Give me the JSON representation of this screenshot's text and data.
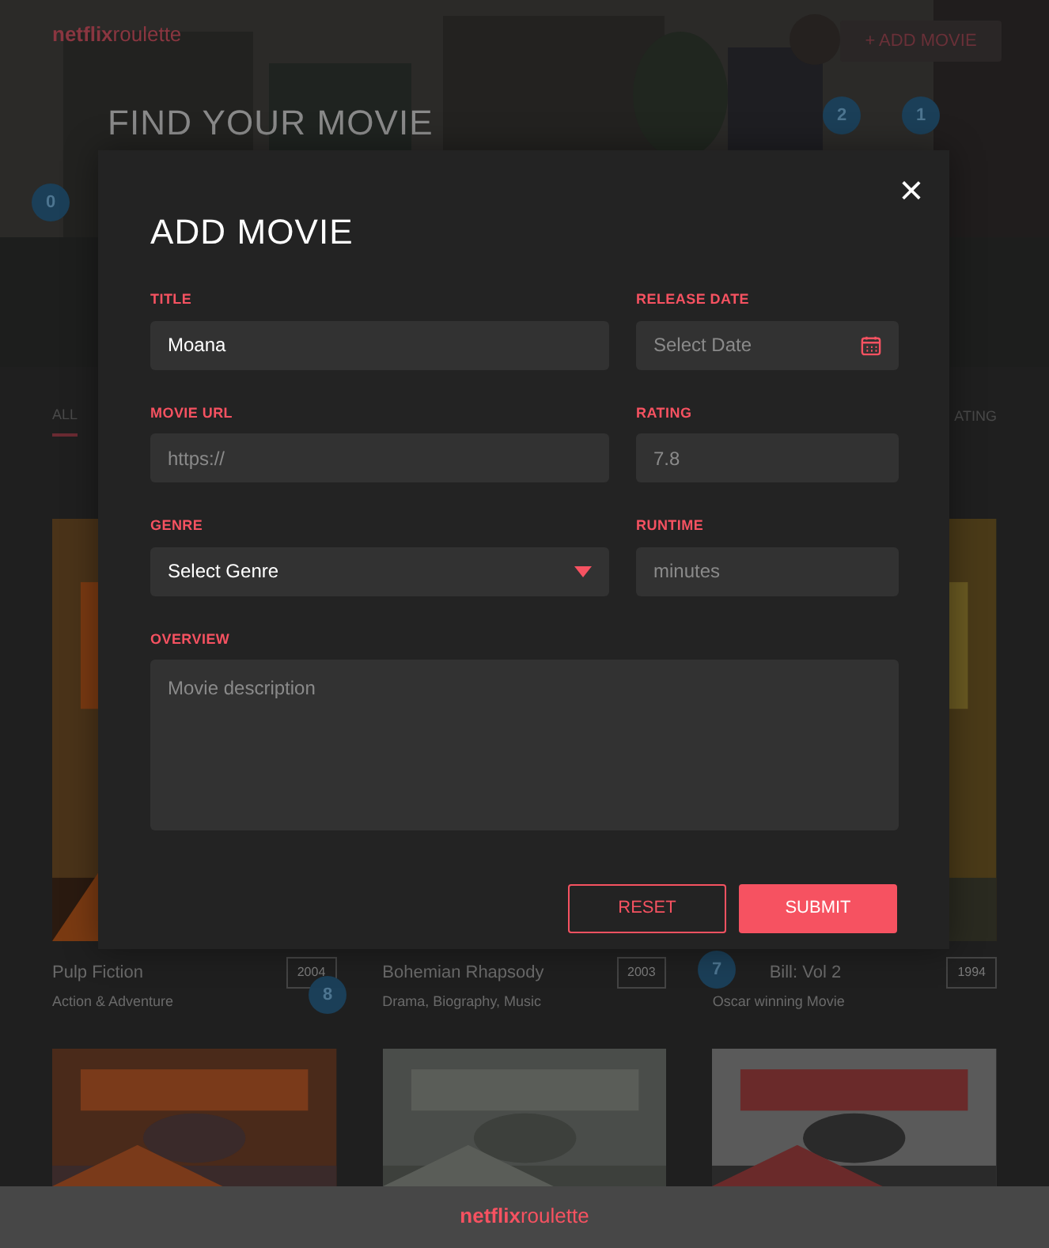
{
  "header": {
    "logo": {
      "bold": "netflix",
      "light": "roulette"
    },
    "add_button": "+ ADD MOVIE",
    "title": "FIND YOUR MOVIE"
  },
  "annotations": [
    {
      "label": "0"
    },
    {
      "label": "2"
    },
    {
      "label": "1"
    },
    {
      "label": "8"
    },
    {
      "label": "7"
    }
  ],
  "filter": {
    "tabs": [
      {
        "label": "ALL",
        "selected": true
      }
    ],
    "sort": "ATING"
  },
  "movies": [
    {
      "title": "Pulp Fiction",
      "year": "2004",
      "genre": "Action & Adventure"
    },
    {
      "title": "Bohemian Rhapsody",
      "year": "2003",
      "genre": "Drama, Biography, Music"
    },
    {
      "title": "Bill: Vol 2",
      "year": "1994",
      "genre": "Oscar winning Movie"
    }
  ],
  "footer": {
    "logo": {
      "bold": "netflix",
      "light": "roulette"
    }
  },
  "modal": {
    "title": "ADD MOVIE",
    "close": "×",
    "fields": [
      {
        "label": "TITLE",
        "kind": "text",
        "value": "Moana"
      },
      {
        "label": "RELEASE DATE",
        "kind": "date",
        "placeholder": "Select Date"
      },
      {
        "label": "MOVIE URL",
        "kind": "text",
        "placeholder": "https://"
      },
      {
        "label": "RATING",
        "kind": "text",
        "placeholder": "7.8"
      },
      {
        "label": "GENRE",
        "kind": "select",
        "placeholder": "Select Genre"
      },
      {
        "label": "RUNTIME",
        "kind": "text",
        "placeholder": "minutes"
      },
      {
        "label": "OVERVIEW",
        "kind": "textarea",
        "placeholder": "Movie description"
      }
    ],
    "buttons": [
      {
        "label": "RESET",
        "kind": "secondary"
      },
      {
        "label": "SUBMIT",
        "kind": "primary"
      }
    ]
  }
}
